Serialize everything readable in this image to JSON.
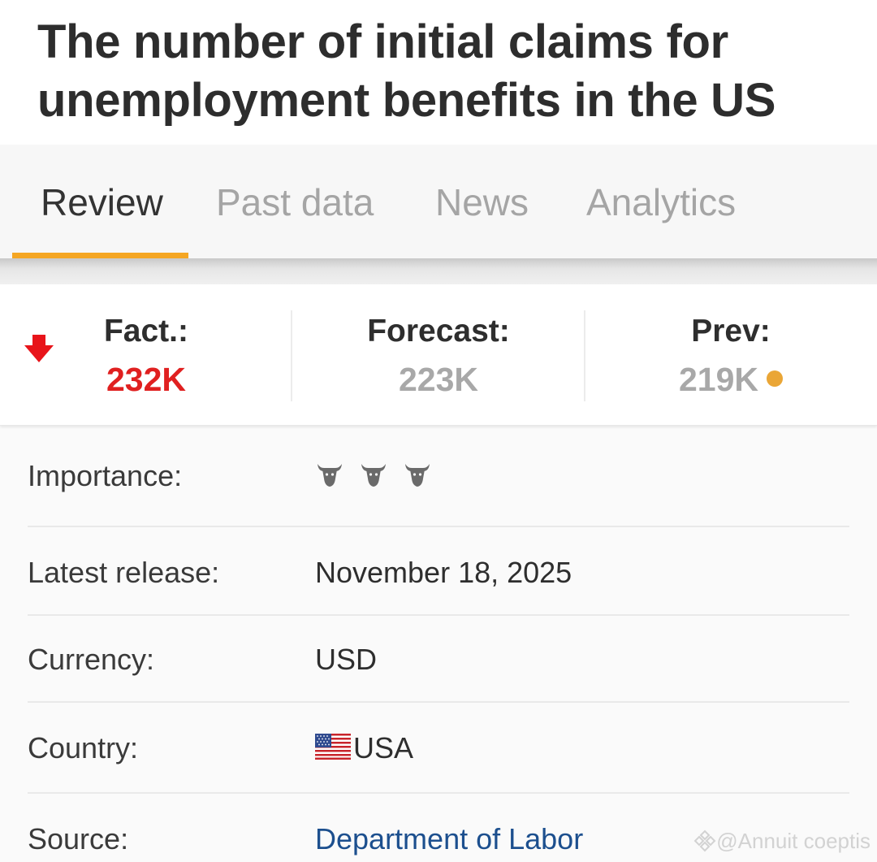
{
  "header": {
    "title": "The number of initial claims for unemployment benefits in the US"
  },
  "tabs": [
    {
      "label": "Review",
      "active": true
    },
    {
      "label": "Past data",
      "active": false
    },
    {
      "label": "News",
      "active": false
    },
    {
      "label": "Analytics",
      "active": false
    }
  ],
  "stats": {
    "fact": {
      "label": "Fact.:",
      "value": "232K",
      "trend_icon": "down-arrow-icon",
      "color": "#e02020"
    },
    "forecast": {
      "label": "Forecast:",
      "value": "223K"
    },
    "prev": {
      "label": "Prev:",
      "value": "219K",
      "indicator_color": "#eaa636"
    }
  },
  "details": {
    "importance": {
      "label": "Importance:",
      "level": 3,
      "icon": "bull-icon"
    },
    "latest_release": {
      "label": "Latest release:",
      "value": "November 18, 2025"
    },
    "currency": {
      "label": "Currency:",
      "value": "USD"
    },
    "country": {
      "label": "Country:",
      "value": "USA",
      "icon": "us-flag-icon"
    },
    "source": {
      "label": "Source:",
      "value": "Department of Labor"
    }
  },
  "watermark": {
    "text": "@Annuit coeptis"
  },
  "colors": {
    "accent": "#f5a623",
    "fact_red": "#e02020",
    "link": "#1c4f8e"
  }
}
